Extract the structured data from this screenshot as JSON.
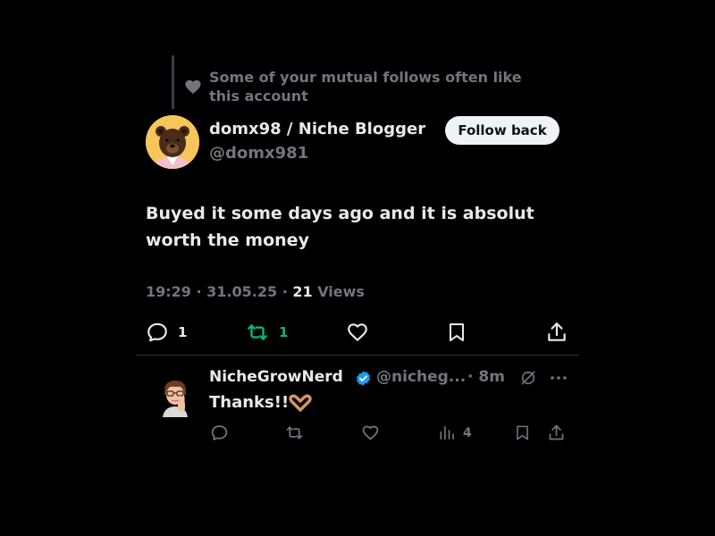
{
  "social_context": {
    "text": "Some of your mutual follows often like this account"
  },
  "author": {
    "name": "domx98 / Niche Blogger",
    "handle": "@domx981"
  },
  "follow_button": {
    "label": "Follow back"
  },
  "tweet": {
    "text": "Buyed it some days ago and it is absolut worth the money"
  },
  "meta": {
    "time": "19:29",
    "date": "31.05.25",
    "views_count": "21",
    "views_label": "Views",
    "separator": "·"
  },
  "actions": {
    "replies": "1",
    "reposts": "1"
  },
  "reply": {
    "author_name": "NicheGrowNerd",
    "handle": "@nicheg...",
    "time": "· 8m",
    "text": "Thanks!!",
    "views": "4"
  },
  "colors": {
    "background": "#000000",
    "text": "#e7e9ea",
    "secondary": "#71767b",
    "repost_active": "#00ba7c",
    "verified": "#1d9bf0"
  }
}
